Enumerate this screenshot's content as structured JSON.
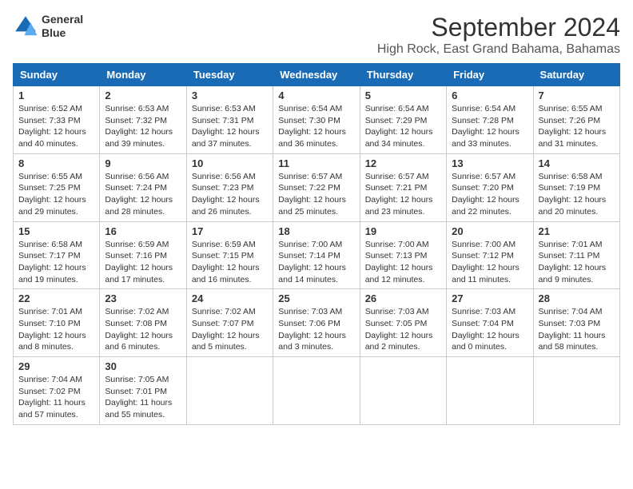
{
  "header": {
    "logo_line1": "General",
    "logo_line2": "Blue",
    "month": "September 2024",
    "location": "High Rock, East Grand Bahama, Bahamas"
  },
  "weekdays": [
    "Sunday",
    "Monday",
    "Tuesday",
    "Wednesday",
    "Thursday",
    "Friday",
    "Saturday"
  ],
  "weeks": [
    [
      {
        "day": "1",
        "sunrise": "6:52 AM",
        "sunset": "7:33 PM",
        "daylight": "12 hours and 40 minutes."
      },
      {
        "day": "2",
        "sunrise": "6:53 AM",
        "sunset": "7:32 PM",
        "daylight": "12 hours and 39 minutes."
      },
      {
        "day": "3",
        "sunrise": "6:53 AM",
        "sunset": "7:31 PM",
        "daylight": "12 hours and 37 minutes."
      },
      {
        "day": "4",
        "sunrise": "6:54 AM",
        "sunset": "7:30 PM",
        "daylight": "12 hours and 36 minutes."
      },
      {
        "day": "5",
        "sunrise": "6:54 AM",
        "sunset": "7:29 PM",
        "daylight": "12 hours and 34 minutes."
      },
      {
        "day": "6",
        "sunrise": "6:54 AM",
        "sunset": "7:28 PM",
        "daylight": "12 hours and 33 minutes."
      },
      {
        "day": "7",
        "sunrise": "6:55 AM",
        "sunset": "7:26 PM",
        "daylight": "12 hours and 31 minutes."
      }
    ],
    [
      {
        "day": "8",
        "sunrise": "6:55 AM",
        "sunset": "7:25 PM",
        "daylight": "12 hours and 29 minutes."
      },
      {
        "day": "9",
        "sunrise": "6:56 AM",
        "sunset": "7:24 PM",
        "daylight": "12 hours and 28 minutes."
      },
      {
        "day": "10",
        "sunrise": "6:56 AM",
        "sunset": "7:23 PM",
        "daylight": "12 hours and 26 minutes."
      },
      {
        "day": "11",
        "sunrise": "6:57 AM",
        "sunset": "7:22 PM",
        "daylight": "12 hours and 25 minutes."
      },
      {
        "day": "12",
        "sunrise": "6:57 AM",
        "sunset": "7:21 PM",
        "daylight": "12 hours and 23 minutes."
      },
      {
        "day": "13",
        "sunrise": "6:57 AM",
        "sunset": "7:20 PM",
        "daylight": "12 hours and 22 minutes."
      },
      {
        "day": "14",
        "sunrise": "6:58 AM",
        "sunset": "7:19 PM",
        "daylight": "12 hours and 20 minutes."
      }
    ],
    [
      {
        "day": "15",
        "sunrise": "6:58 AM",
        "sunset": "7:17 PM",
        "daylight": "12 hours and 19 minutes."
      },
      {
        "day": "16",
        "sunrise": "6:59 AM",
        "sunset": "7:16 PM",
        "daylight": "12 hours and 17 minutes."
      },
      {
        "day": "17",
        "sunrise": "6:59 AM",
        "sunset": "7:15 PM",
        "daylight": "12 hours and 16 minutes."
      },
      {
        "day": "18",
        "sunrise": "7:00 AM",
        "sunset": "7:14 PM",
        "daylight": "12 hours and 14 minutes."
      },
      {
        "day": "19",
        "sunrise": "7:00 AM",
        "sunset": "7:13 PM",
        "daylight": "12 hours and 12 minutes."
      },
      {
        "day": "20",
        "sunrise": "7:00 AM",
        "sunset": "7:12 PM",
        "daylight": "12 hours and 11 minutes."
      },
      {
        "day": "21",
        "sunrise": "7:01 AM",
        "sunset": "7:11 PM",
        "daylight": "12 hours and 9 minutes."
      }
    ],
    [
      {
        "day": "22",
        "sunrise": "7:01 AM",
        "sunset": "7:10 PM",
        "daylight": "12 hours and 8 minutes."
      },
      {
        "day": "23",
        "sunrise": "7:02 AM",
        "sunset": "7:08 PM",
        "daylight": "12 hours and 6 minutes."
      },
      {
        "day": "24",
        "sunrise": "7:02 AM",
        "sunset": "7:07 PM",
        "daylight": "12 hours and 5 minutes."
      },
      {
        "day": "25",
        "sunrise": "7:03 AM",
        "sunset": "7:06 PM",
        "daylight": "12 hours and 3 minutes."
      },
      {
        "day": "26",
        "sunrise": "7:03 AM",
        "sunset": "7:05 PM",
        "daylight": "12 hours and 2 minutes."
      },
      {
        "day": "27",
        "sunrise": "7:03 AM",
        "sunset": "7:04 PM",
        "daylight": "12 hours and 0 minutes."
      },
      {
        "day": "28",
        "sunrise": "7:04 AM",
        "sunset": "7:03 PM",
        "daylight": "11 hours and 58 minutes."
      }
    ],
    [
      {
        "day": "29",
        "sunrise": "7:04 AM",
        "sunset": "7:02 PM",
        "daylight": "11 hours and 57 minutes."
      },
      {
        "day": "30",
        "sunrise": "7:05 AM",
        "sunset": "7:01 PM",
        "daylight": "11 hours and 55 minutes."
      },
      null,
      null,
      null,
      null,
      null
    ]
  ]
}
